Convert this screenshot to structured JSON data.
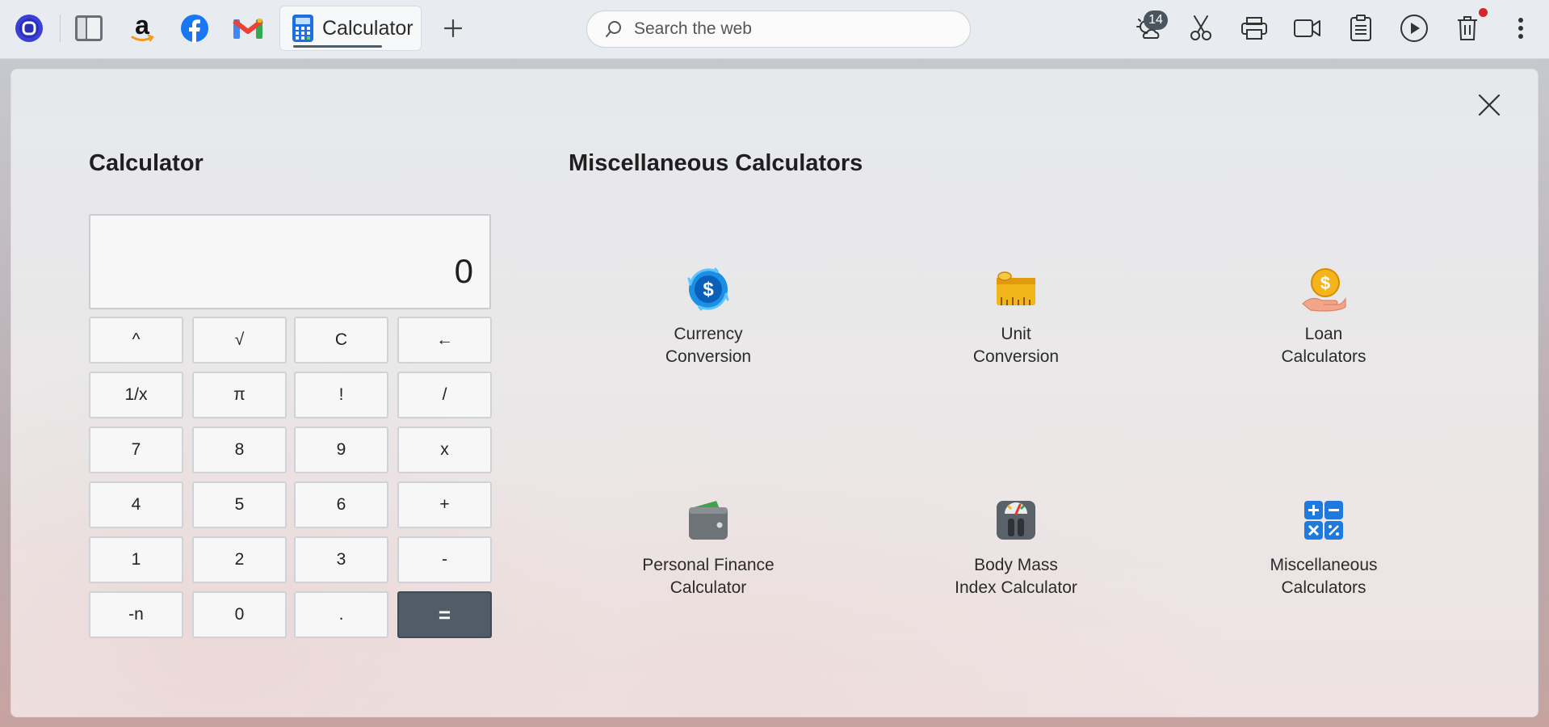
{
  "taskbar": {
    "pinned": [
      {
        "name": "start-app-icon"
      },
      {
        "name": "file-manager-icon"
      },
      {
        "name": "amazon-icon"
      },
      {
        "name": "facebook-icon"
      },
      {
        "name": "gmail-icon"
      }
    ],
    "active_tab": {
      "label": "Calculator",
      "icon": "calculator-icon"
    },
    "new_tab_icon": "plus-icon",
    "search": {
      "placeholder": "Search the web"
    },
    "right_icons": [
      "weather-icon",
      "scissors-icon",
      "printer-icon",
      "video-camera-icon",
      "clipboard-icon",
      "play-icon",
      "trash-icon",
      "more-icon"
    ],
    "weather_badge": "14"
  },
  "calculator": {
    "title": "Calculator",
    "display": "0",
    "keys": [
      [
        "^",
        "√",
        "C",
        "←"
      ],
      [
        "1/x",
        "π",
        "!",
        "/"
      ],
      [
        "7",
        "8",
        "9",
        "x"
      ],
      [
        "4",
        "5",
        "6",
        "+"
      ],
      [
        "1",
        "2",
        "3",
        "-"
      ],
      [
        "-n",
        "0",
        ".",
        "="
      ]
    ]
  },
  "misc": {
    "title": "Miscellaneous Calculators",
    "tiles": [
      {
        "line1": "Currency",
        "line2": "Conversion",
        "icon": "currency-exchange-icon"
      },
      {
        "line1": "Unit",
        "line2": "Conversion",
        "icon": "measuring-tape-icon"
      },
      {
        "line1": "Loan",
        "line2": "Calculators",
        "icon": "coin-in-hand-icon"
      },
      {
        "line1": "Personal Finance",
        "line2": "Calculator",
        "icon": "wallet-icon"
      },
      {
        "line1": "Body Mass",
        "line2": "Index Calculator",
        "icon": "bathroom-scale-icon"
      },
      {
        "line1": "Miscellaneous",
        "line2": "Calculators",
        "icon": "math-operators-icon"
      }
    ]
  },
  "colors": {
    "accent_dark": "#505d69",
    "facebook_blue": "#1877f2",
    "notification_red": "#d3262a"
  }
}
